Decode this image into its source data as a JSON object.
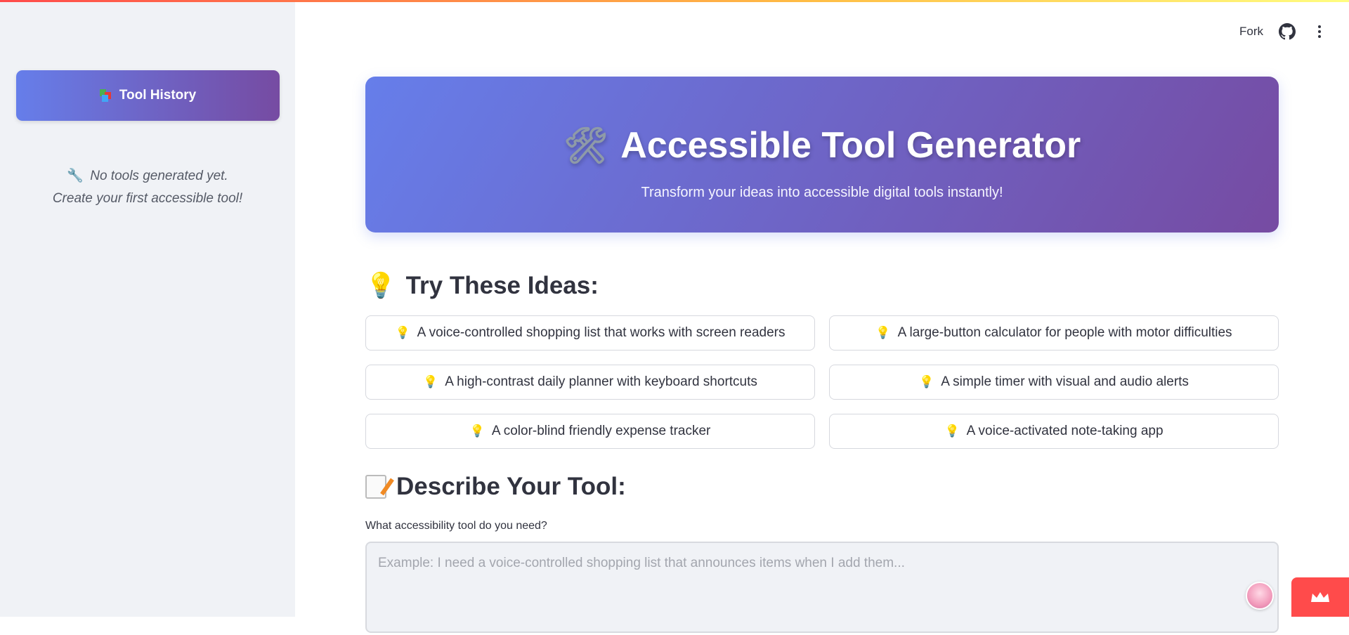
{
  "colors": {
    "accent_start": "#667eea",
    "accent_end": "#764ba2",
    "badge": "#ff4b4b",
    "sidebar_bg": "#f0f2f6"
  },
  "header": {
    "fork_label": "Fork",
    "github_icon": "github-icon",
    "menu_icon": "more-vertical-icon"
  },
  "sidebar": {
    "history_button_label": "Tool History",
    "history_icon": "books-icon",
    "empty_line1": "No tools generated yet.",
    "empty_line2": "Create your first accessible tool!",
    "empty_icon": "wrench-icon"
  },
  "hero": {
    "title": "Accessible Tool Generator",
    "icon": "hammer-and-wrench-icon",
    "subtitle": "Transform your ideas into accessible digital tools instantly!"
  },
  "ideas": {
    "title": "Try These Ideas:",
    "icon": "light-bulb-icon",
    "items": [
      "A voice-controlled shopping list that works with screen readers",
      "A large-button calculator for people with motor difficulties",
      "A high-contrast daily planner with keyboard shortcuts",
      "A simple timer with visual and audio alerts",
      "A color-blind friendly expense tracker",
      "A voice-activated note-taking app"
    ]
  },
  "describe": {
    "title": "Describe Your Tool:",
    "icon": "memo-icon",
    "field_label": "What accessibility tool do you need?",
    "placeholder": "Example: I need a voice-controlled shopping list that announces items when I add them...",
    "value": ""
  }
}
